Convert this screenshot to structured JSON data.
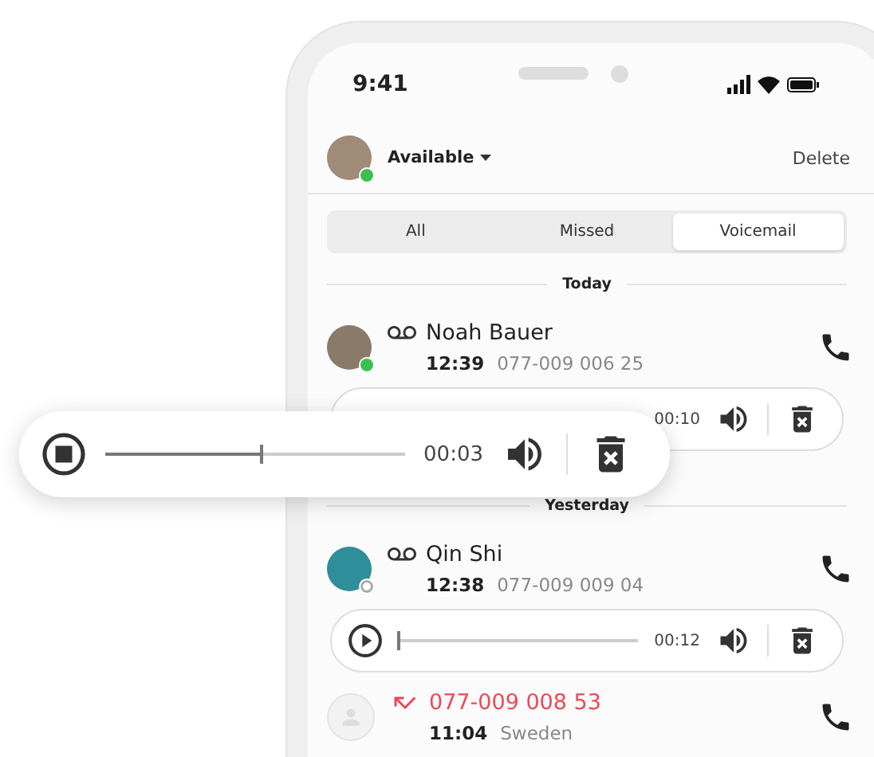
{
  "status_bar": {
    "time": "9:41"
  },
  "header": {
    "status": "Available",
    "online": true,
    "action": "Delete"
  },
  "tabs": [
    {
      "label": "All",
      "selected": false
    },
    {
      "label": "Missed",
      "selected": false
    },
    {
      "label": "Voicemail",
      "selected": true
    }
  ],
  "sections": [
    {
      "title": "Today",
      "calls": [
        {
          "kind": "voicemail",
          "name": "Noah Bauer",
          "online": true,
          "time": "12:39",
          "detail": "077-009 006 25",
          "player": {
            "duration": "00:10"
          }
        }
      ]
    },
    {
      "title": "Yesterday",
      "calls": [
        {
          "kind": "voicemail",
          "name": "Qin Shi",
          "online": false,
          "time": "12:38",
          "detail": "077-009 009 04",
          "player": {
            "playing": false,
            "duration": "00:12",
            "level": 0
          }
        },
        {
          "kind": "missed",
          "name": "077-009 008 53",
          "time": "11:04",
          "detail": "Sweden"
        }
      ]
    }
  ],
  "floating_player": {
    "playing": true,
    "duration": "00:03",
    "level": 0.52
  }
}
